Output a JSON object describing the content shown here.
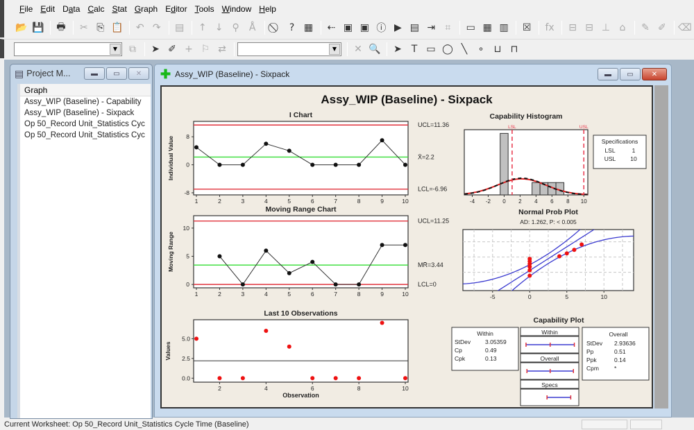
{
  "menu": [
    {
      "label": "File",
      "u": "F",
      "rest": "ile"
    },
    {
      "label": "Edit",
      "u": "E",
      "rest": "dit"
    },
    {
      "label": "Data",
      "pre": "D",
      "u": "a",
      "rest": "ta"
    },
    {
      "label": "Calc",
      "u": "C",
      "rest": "alc"
    },
    {
      "label": "Stat",
      "u": "S",
      "rest": "tat"
    },
    {
      "label": "Graph",
      "u": "G",
      "rest": "raph"
    },
    {
      "label": "Editor",
      "pre": "E",
      "u": "d",
      "rest": "itor"
    },
    {
      "label": "Tools",
      "u": "T",
      "rest": "ools"
    },
    {
      "label": "Window",
      "u": "W",
      "rest": "indow"
    },
    {
      "label": "Help",
      "u": "H",
      "rest": "elp"
    }
  ],
  "toolbar1": [
    {
      "name": "open-icon",
      "glyph": "📂"
    },
    {
      "name": "save-icon",
      "glyph": "💾"
    },
    {
      "sep": true
    },
    {
      "name": "print-icon",
      "glyph": "🖶"
    },
    {
      "sep": true
    },
    {
      "name": "cut-icon",
      "glyph": "✂",
      "dim": true
    },
    {
      "name": "copy-icon",
      "glyph": "⎘"
    },
    {
      "name": "paste-icon",
      "glyph": "📋"
    },
    {
      "sep": true
    },
    {
      "name": "undo-icon",
      "glyph": "↶",
      "dim": true
    },
    {
      "name": "redo-icon",
      "glyph": "↷",
      "dim": true
    },
    {
      "sep": true
    },
    {
      "name": "session-icon",
      "glyph": "▤",
      "dim": true
    },
    {
      "sep": true
    },
    {
      "name": "previous-icon",
      "glyph": "↑",
      "dim": true
    },
    {
      "name": "next-icon",
      "glyph": "↓",
      "dim": true
    },
    {
      "name": "find-icon",
      "glyph": "⚲",
      "dim": true
    },
    {
      "name": "replace-icon",
      "glyph": "Å",
      "dim": true
    },
    {
      "sep": true
    },
    {
      "name": "cancel-icon",
      "glyph": "⃠"
    },
    {
      "name": "help-icon",
      "glyph": "?"
    },
    {
      "name": "assistant-icon",
      "glyph": "▦"
    },
    {
      "sep": true
    },
    {
      "name": "project-manager-icon",
      "glyph": "⇠"
    },
    {
      "name": "show-graphs-icon",
      "glyph": "▣"
    },
    {
      "name": "graph-folder-icon",
      "glyph": "▣"
    },
    {
      "name": "info-icon",
      "glyph": "ⓘ"
    },
    {
      "name": "history-icon",
      "glyph": "▶"
    },
    {
      "name": "report-pad-icon",
      "glyph": "▤"
    },
    {
      "name": "related-docs-icon",
      "glyph": "⇥"
    },
    {
      "name": "design-icon",
      "glyph": "⌗",
      "dim": true
    },
    {
      "sep": true
    },
    {
      "name": "session-window-icon",
      "glyph": "▭"
    },
    {
      "name": "data-window-icon",
      "glyph": "▦"
    },
    {
      "name": "worksheet-icon",
      "glyph": "▥"
    },
    {
      "sep": true
    },
    {
      "name": "close-graphs-icon",
      "glyph": "☒"
    },
    {
      "sep": true
    },
    {
      "name": "formula-icon",
      "glyph": "fx",
      "dim": true
    },
    {
      "sep": true
    },
    {
      "name": "insert-row-icon",
      "glyph": "⊟",
      "dim": true
    },
    {
      "name": "insert-col-icon",
      "glyph": "⊟",
      "dim": true
    },
    {
      "name": "move-col-icon",
      "glyph": "⊥",
      "dim": true
    },
    {
      "name": "define-icon",
      "glyph": "⌂",
      "dim": true
    },
    {
      "sep": true
    },
    {
      "name": "brush-icon",
      "glyph": "✎",
      "dim": true
    },
    {
      "name": "set-id-icon",
      "glyph": "✐",
      "dim": true
    },
    {
      "sep": true
    },
    {
      "name": "eraser-icon",
      "glyph": "⌫",
      "dim": true
    }
  ],
  "toolbar2": {
    "combo1_value": "",
    "combo2_value": "",
    "tools_a": [
      {
        "name": "select-arrow-icon",
        "glyph": "➤"
      },
      {
        "name": "brush-tool-icon",
        "glyph": "✐"
      },
      {
        "name": "crosshair-icon",
        "glyph": "+",
        "dim": true
      },
      {
        "name": "flag-icon",
        "glyph": "⚐",
        "dim": true
      },
      {
        "name": "swap-icon",
        "glyph": "⇄",
        "dim": true
      }
    ],
    "tools_b": [
      {
        "name": "delete-icon",
        "glyph": "✕",
        "dim": true
      },
      {
        "name": "zoom-icon",
        "glyph": "🔍"
      }
    ],
    "tools_c": [
      {
        "name": "pointer-icon",
        "glyph": "➤"
      },
      {
        "name": "text-tool-icon",
        "glyph": "T"
      },
      {
        "name": "rectangle-icon",
        "glyph": "▭"
      },
      {
        "name": "ellipse-icon",
        "glyph": "◯"
      },
      {
        "name": "line-icon",
        "glyph": "╲"
      },
      {
        "name": "marker-icon",
        "glyph": "∘"
      },
      {
        "name": "polyline-icon",
        "glyph": "⊔"
      },
      {
        "name": "polygon-icon",
        "glyph": "⊓"
      }
    ]
  },
  "project_manager": {
    "title": "Project M...",
    "header": "Graph",
    "items": [
      "Assy_WIP (Baseline) - Capability",
      "Assy_WIP (Baseline) - Sixpack",
      "Op 50_Record Unit_Statistics Cyc",
      "Op 50_Record Unit_Statistics Cyc"
    ]
  },
  "graph_window": {
    "title": "Assy_WIP (Baseline) - Sixpack"
  },
  "status": {
    "text": "Current Worksheet: Op 50_Record Unit_Statistics Cycle Time (Baseline)"
  },
  "colors": {
    "limit_line": "#e0303a",
    "center_line": "#33dd33",
    "point": "#111111",
    "red_point": "#ee1111",
    "blue_band": "#3a3ad0",
    "hist_bar": "#c0c0c0"
  },
  "chart_data": [
    {
      "type": "line",
      "title": "I Chart",
      "suptitle": "Assy_WIP (Baseline) - Sixpack",
      "ylabel": "Individual Value",
      "x": [
        1,
        2,
        3,
        4,
        5,
        6,
        7,
        8,
        9,
        10
      ],
      "values": [
        5,
        0,
        0,
        6,
        4,
        0,
        0,
        0,
        7,
        0
      ],
      "yticks": [
        -8,
        0,
        8
      ],
      "xticks": [
        1,
        2,
        3,
        4,
        5,
        6,
        7,
        8,
        9,
        10
      ],
      "ylim": [
        -8.6,
        12.4
      ],
      "ucl": 11.36,
      "center": 2.2,
      "lcl": -6.96,
      "ucl_label": "UCL=11.36",
      "center_label": "X̄=2.2",
      "lcl_label": "LCL=-6.96"
    },
    {
      "type": "line",
      "title": "Moving Range Chart",
      "ylabel": "Moving Range",
      "x": [
        2,
        3,
        4,
        5,
        6,
        7,
        8,
        9,
        10
      ],
      "values": [
        5,
        0,
        6,
        2,
        4,
        0,
        0,
        7,
        7
      ],
      "yticks": [
        0,
        5,
        10
      ],
      "xticks": [
        1,
        2,
        3,
        4,
        5,
        6,
        7,
        8,
        9,
        10
      ],
      "ylim": [
        -0.6,
        12.2
      ],
      "ucl": 11.25,
      "center": 3.44,
      "lcl": 0,
      "ucl_label": "UCL=11.25",
      "center_label": "MR̄=3.44",
      "lcl_label": "LCL=0"
    },
    {
      "type": "scatter",
      "title": "Last 10 Observations",
      "xlabel": "Observation",
      "ylabel": "Values",
      "x": [
        1,
        2,
        3,
        4,
        5,
        6,
        7,
        8,
        9,
        10
      ],
      "values": [
        5,
        0,
        0,
        6,
        4,
        0,
        0,
        0,
        7,
        0
      ],
      "yticks": [
        "0.0",
        "2.5",
        "5.0"
      ],
      "ytick_values": [
        0,
        2.5,
        5
      ],
      "xticks": [
        2,
        4,
        6,
        8,
        10
      ],
      "ylim": [
        -0.5,
        7.4
      ],
      "reference_line": 2.2
    },
    {
      "type": "bar",
      "title": "Capability Histogram",
      "bins": [
        {
          "x0": -0.5,
          "x1": 0.5,
          "count": 5
        },
        {
          "x0": 3.5,
          "x1": 4.5,
          "count": 1
        },
        {
          "x0": 4.5,
          "x1": 5.5,
          "count": 1
        },
        {
          "x0": 5.5,
          "x1": 6.5,
          "count": 1
        },
        {
          "x0": 6.5,
          "x1": 7.5,
          "count": 1
        }
      ],
      "xticks": [
        -4,
        -2,
        0,
        2,
        4,
        6,
        8,
        10
      ],
      "xlim": [
        -5,
        10.5
      ],
      "ylim": [
        0,
        5.3
      ],
      "lsl": 1,
      "usl": 10,
      "lsl_label": "LSL",
      "usl_label": "USL",
      "normal_curve": {
        "mean": 2.2,
        "sd_within": 3.05359,
        "sd_overall": 2.93636
      },
      "specifications": {
        "title": "Specifications",
        "rows": [
          [
            "LSL",
            "1"
          ],
          [
            "USL",
            "10"
          ]
        ]
      }
    },
    {
      "type": "scatter",
      "title": "Normal Prob Plot",
      "subtitle": "AD: 1.262, P: < 0.005",
      "x": [
        0,
        0,
        0,
        0,
        0,
        0,
        4,
        5,
        6,
        7
      ],
      "xticks": [
        -5,
        0,
        5,
        10
      ],
      "xlim": [
        -9,
        14
      ]
    },
    {
      "type": "table",
      "title": "Capability Plot",
      "within": {
        "title": "Within",
        "rows": [
          [
            "StDev",
            "3.05359"
          ],
          [
            "Cp",
            "0.49"
          ],
          [
            "Cpk",
            "0.13"
          ]
        ]
      },
      "overall": {
        "title": "Overall",
        "rows": [
          [
            "StDev",
            "2.93636"
          ],
          [
            "Pp",
            "0.51"
          ],
          [
            "Ppk",
            "0.14"
          ],
          [
            "Cpm",
            "*"
          ]
        ]
      },
      "intervals": [
        {
          "label": "Within",
          "low": -6.96,
          "mid": 2.2,
          "high": 11.36
        },
        {
          "label": "Overall",
          "low": -6.61,
          "mid": 2.2,
          "high": 11.01
        },
        {
          "label": "Specs",
          "low": 1,
          "high": 10
        }
      ]
    }
  ]
}
